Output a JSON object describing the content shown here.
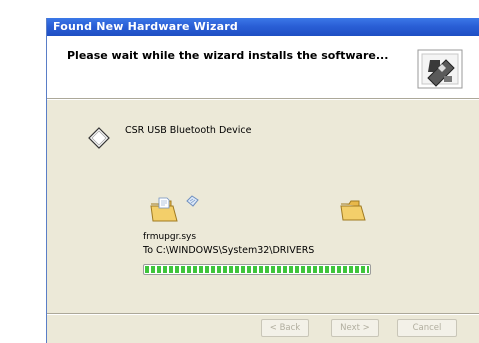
{
  "window": {
    "title": "Found New Hardware Wizard"
  },
  "header": {
    "message": "Please wait while the wizard installs the software...",
    "icon": "hardware-wizard-icon"
  },
  "device": {
    "icon": "device-diamond-icon",
    "name": "CSR USB Bluetooth Device"
  },
  "copy": {
    "source_icon": "folder-icon",
    "transfer_icon": "document-flying-icon",
    "dest_icon": "folder-icon",
    "file_name": "frmupgr.sys",
    "destination": "To C:\\WINDOWS\\System32\\DRIVERS",
    "progress": 1.0
  },
  "buttons": {
    "back": "< Back",
    "next": "Next >",
    "cancel": "Cancel"
  },
  "colors": {
    "titlebar": "#2a5fd6",
    "dialog_bg": "#ece9d8",
    "progress": "#3fc53c"
  }
}
